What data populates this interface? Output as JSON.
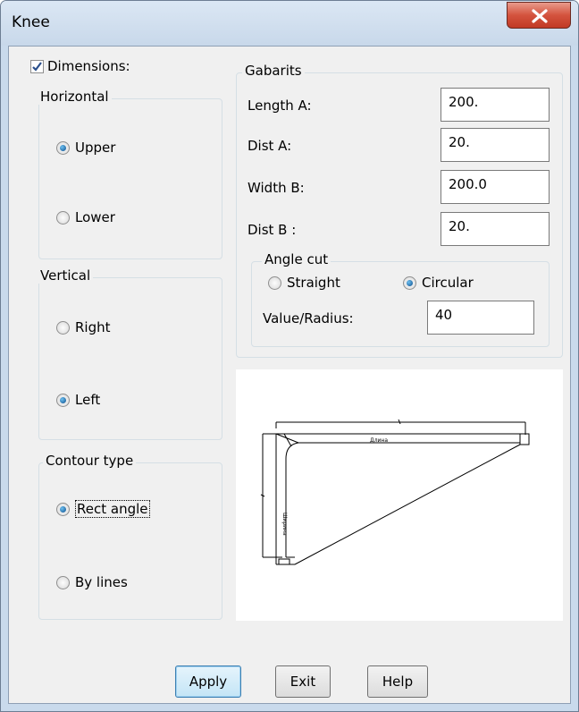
{
  "window": {
    "title": "Knee"
  },
  "dimensions": {
    "label": "Dimensions:",
    "checked": true
  },
  "horizontal": {
    "legend": "Horizontal",
    "options": [
      "Upper",
      "Lower"
    ],
    "selected": "Upper"
  },
  "vertical": {
    "legend": "Vertical",
    "options": [
      "Right",
      "Left"
    ],
    "selected": "Left"
  },
  "contour": {
    "legend": "Contour type",
    "options": [
      "Rect angle",
      "By lines"
    ],
    "selected": "Rect angle"
  },
  "gabarits": {
    "legend": "Gabarits",
    "fields": [
      {
        "label": "Length A:",
        "value": "200."
      },
      {
        "label": "Dist A:",
        "value": "20."
      },
      {
        "label": "Width B:",
        "value": "200.0"
      },
      {
        "label": "Dist B :",
        "value": "20."
      }
    ]
  },
  "angle_cut": {
    "legend": "Angle cut",
    "options": [
      "Straight",
      "Circular"
    ],
    "selected": "Circular",
    "value_label": "Value/Radius:",
    "value": "40"
  },
  "preview": {
    "label_a": "Длина",
    "label_b": "Ширина"
  },
  "buttons": {
    "apply": "Apply",
    "exit": "Exit",
    "help": "Help"
  }
}
